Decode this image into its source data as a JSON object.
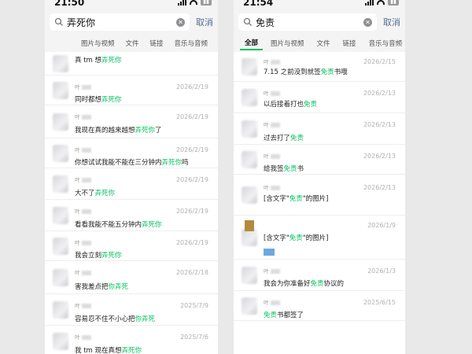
{
  "left": {
    "status_time": "21:50",
    "search_query": "弄死你",
    "cancel_label": "取消",
    "tabs": [
      "图片与视频",
      "文件",
      "链接",
      "音乐与音频"
    ],
    "highlight_color": "#07c160",
    "items": [
      {
        "sender": "",
        "date": "",
        "pre": "真 tm 想",
        "hl": "弄死你",
        "post": ""
      },
      {
        "sender": "叶",
        "date": "2026/2/19",
        "pre": "同时都想",
        "hl": "弄死你",
        "post": ""
      },
      {
        "sender": "叶",
        "date": "2026/2/19",
        "pre": "我现在真的越来越想",
        "hl": "弄死你",
        "post": "了"
      },
      {
        "sender": "叶",
        "date": "2026/2/19",
        "pre": "你想试试我能不能在三分钟内",
        "hl": "弄死你",
        "post": "吗"
      },
      {
        "sender": "叶",
        "date": "2026/2/19",
        "pre": "大不了",
        "hl": "弄死你",
        "post": ""
      },
      {
        "sender": "叶",
        "date": "2026/2/19",
        "pre": "看看我能不能五分钟内",
        "hl": "弄死你",
        "post": ""
      },
      {
        "sender": "叶",
        "date": "2026/2/19",
        "pre": "我会立刻",
        "hl": "弄死你",
        "post": ""
      },
      {
        "sender": "叶",
        "date": "2026/2/18",
        "pre": "害我差点把",
        "hl": "你弄死",
        "post": ""
      },
      {
        "sender": "叶",
        "date": "2025/7/9",
        "pre": "容易忍不住不小心把",
        "hl": "你弄死",
        "post": ""
      },
      {
        "sender": "叶",
        "date": "2025/7/6",
        "pre": "我 tm 现在真想",
        "hl": "弄死你",
        "post": ""
      }
    ]
  },
  "right": {
    "status_time": "21:54",
    "search_query": "免责",
    "cancel_label": "取消",
    "tabs": [
      "全部",
      "图片与视频",
      "文件",
      "链接",
      "音乐与音频"
    ],
    "highlight_color": "#07c160",
    "items": [
      {
        "sender": "叶",
        "date": "2026/2/15",
        "pre": "7.15 之前没到就签",
        "hl": "免责",
        "post": "书哦"
      },
      {
        "sender": "叶",
        "date": "2026/2/13",
        "pre": "以后接着打也",
        "hl": "免责",
        "post": ""
      },
      {
        "sender": "叶",
        "date": "2026/2/13",
        "pre": "过去打了",
        "hl": "免责",
        "post": ""
      },
      {
        "sender": "叶",
        "date": "2026/2/13",
        "pre": "给我签",
        "hl": "免责",
        "post": "书"
      },
      {
        "sender": "叶",
        "date": "2026/2/13",
        "pre": "[含文字\"",
        "hl": "免责",
        "post": "\"的图片]"
      },
      {
        "sender": "",
        "date": "2026/1/9",
        "pre": "[含文字\"",
        "hl": "免责",
        "post": "\"的图片]"
      },
      {
        "sender": "叶",
        "date": "2026/1/3",
        "pre": "我会为你准备好",
        "hl": "免责",
        "post": "协议的"
      },
      {
        "sender": "叶",
        "date": "2025/6/15",
        "pre": "",
        "hl": "免责",
        "post": "书都签了"
      }
    ]
  }
}
